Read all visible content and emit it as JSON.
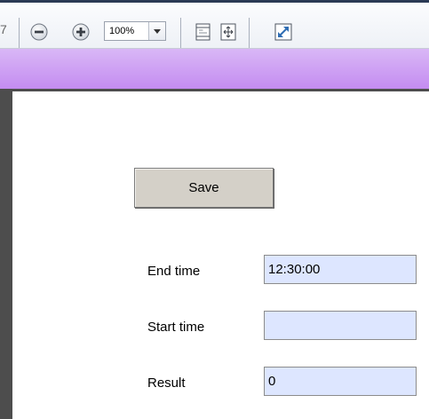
{
  "toolbar": {
    "edge_glyph": "7",
    "zoom": {
      "value": "100%"
    },
    "icons": {
      "zoom_out": "minus-circle-icon",
      "zoom_in": "plus-circle-icon",
      "fit_page": "fit-page-icon",
      "fit_width": "fit-width-icon",
      "fullscreen": "fullscreen-icon"
    }
  },
  "form": {
    "save_label": "Save",
    "fields": [
      {
        "label": "End time",
        "value": "12:30:00"
      },
      {
        "label": "Start time",
        "value": ""
      },
      {
        "label": "Result",
        "value": "0"
      }
    ]
  },
  "colors": {
    "banner": "#c48cf1",
    "input_background": "#dde6ff",
    "button_face": "#d4d0c8",
    "dark_border": "#4d4d4d"
  }
}
